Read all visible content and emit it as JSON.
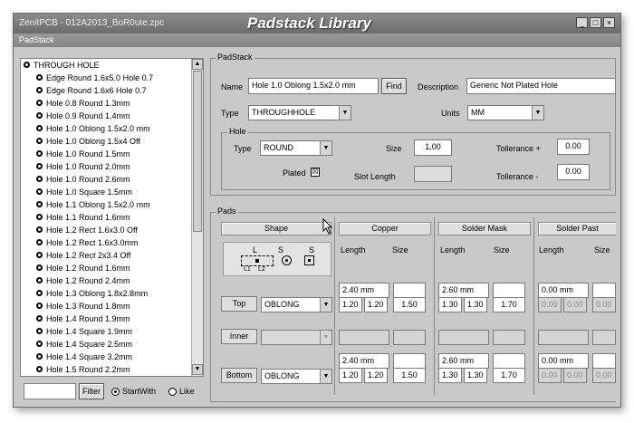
{
  "window": {
    "app_title": "ZenitPCB - 012A2013_BoR0ute.zpc",
    "title": "Padstack Library",
    "minimize": "_",
    "maximize": "□",
    "close": "×",
    "subtitle": "PadStack"
  },
  "list": {
    "root": "THROUGH HOLE",
    "items": [
      "Edge Round 1.6x5.0 Hole 0.7",
      "Edge Round 1.6x6 Hole 0.7",
      "Hole 0.8 Round 1.3mm",
      "Hole 0.9 Round 1.4mm",
      "Hole 1.0 Oblong 1.5x2.0 mm",
      "Hole 1.0 Oblong 1.5x4 Off",
      "Hole 1.0 Round 1.5mm",
      "Hole 1.0 Round 2.0mm",
      "Hole 1.0 Round 2.6mm",
      "Hole 1.0 Square 1.5mm",
      "Hole 1.1 Oblong 1.5x2.0 mm",
      "Hole 1.1 Round 1.6mm",
      "Hole 1.2 Rect 1.6x3.0 Off",
      "Hole 1.2 Rect 1.6x3.0mm",
      "Hole 1.2 Rect 2x3.4 Off",
      "Hole 1.2 Round 1.6mm",
      "Hole 1.2 Round 2.4mm",
      "Hole 1.3 Oblong 1.8x2.8mm",
      "Hole 1.3 Round 1.8mm",
      "Hole 1.4 Round 1.9mm",
      "Hole 1.4 Square 1.9mm",
      "Hole 1.4 Square 2.5mm",
      "Hole 1.4 Square 3.2mm",
      "Hole 1.5 Round 2.2mm"
    ],
    "filter_value": "",
    "filter_button": "Filter",
    "startwith_label": "StartWith",
    "like_label": "Like"
  },
  "padstack": {
    "group_label": "PadStack",
    "name_label": "Name",
    "name_value": "Hole 1.0 Oblong 1.5x2.0 mm",
    "find_button": "Find",
    "description_label": "Description",
    "description_value": "Generic Not Plated Hole",
    "type_label": "Type",
    "type_value": "THROUGHHOLE",
    "units_label": "Units",
    "units_value": "MM"
  },
  "hole": {
    "group_label": "Hole",
    "type_label": "Type",
    "type_value": "ROUND",
    "size_label": "Size",
    "size_value": "1.00",
    "tol_plus_label": "Tollerance +",
    "tol_plus_value": "0.00",
    "plated_label": "Plated",
    "plated_checked": "☒",
    "slot_label": "Slot Length",
    "slot_value": "",
    "tol_minus_label": "Tollerance -",
    "tol_minus_value": "0.00"
  },
  "pads": {
    "group_label": "Pads",
    "shape_header": "Shape",
    "copper_header": "Copper",
    "mask_header": "Solder Mask",
    "paste_header": "Solder Past",
    "length_label": "Length",
    "size_label": "Size",
    "diagram": {
      "l": "L",
      "s1": "S",
      "s2": "S",
      "l1": "L1",
      "l2": "L2"
    },
    "top": {
      "label": "Top",
      "shape": "OBLONG",
      "copper_total": "2.40 mm",
      "copper_l1": "1.20",
      "copper_l2": "1.20",
      "copper_size": "1.50",
      "mask_total": "2.60 mm",
      "mask_l1": "1.30",
      "mask_l2": "1.30",
      "mask_size": "1.70",
      "paste_total": "0.00 mm",
      "paste_l1": "0.00",
      "paste_l2": "0.00",
      "paste_size": "0.00"
    },
    "inner": {
      "label": "Inner",
      "shape": ""
    },
    "bottom": {
      "label": "Bottom",
      "shape": "OBLONG",
      "copper_total": "2.40 mm",
      "copper_l1": "1.20",
      "copper_l2": "1.20",
      "copper_size": "1.50",
      "mask_total": "2.60 mm",
      "mask_l1": "1.30",
      "mask_l2": "1.30",
      "mask_size": "1.70",
      "paste_total": "0.00 mm",
      "paste_l1": "0.00",
      "paste_l2": "0.00",
      "paste_size": "0.00"
    }
  }
}
